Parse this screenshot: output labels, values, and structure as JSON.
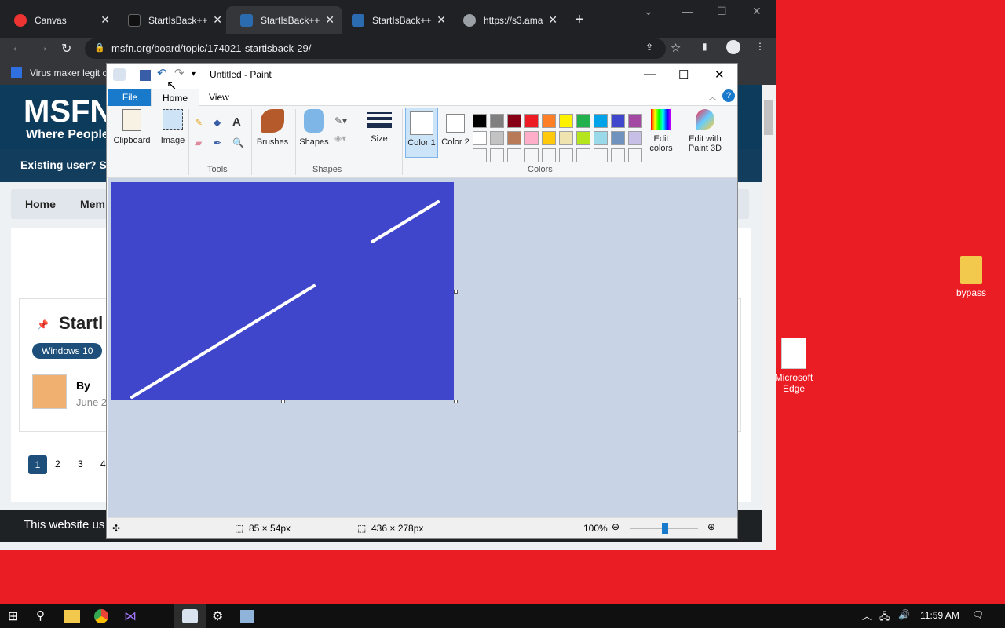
{
  "browser": {
    "tabs": [
      {
        "label": "Canvas",
        "icon": "chrome-red-icon"
      },
      {
        "label": "StartIsBack++",
        "icon": "dark-page-icon"
      },
      {
        "label": "StartIsBack++",
        "icon": "msfn-icon"
      },
      {
        "label": "StartIsBack++",
        "icon": "msfn-icon"
      },
      {
        "label": "https://s3.ama",
        "icon": "globe-icon"
      }
    ],
    "url": "msfn.org/board/topic/174021-startisback-29/",
    "bookmark": "Virus maker legit c"
  },
  "msfn": {
    "logo": "MSFN",
    "tagline": "Where People",
    "signin": "Existing user? Sig",
    "breadcrumb_home": "Home",
    "breadcrumb_members": "Mem",
    "topic_title": "Startl",
    "tag": "Windows 10",
    "by": "By",
    "date": "June 2",
    "pages": [
      "1",
      "2",
      "3",
      "4"
    ],
    "cookie": "This website us"
  },
  "paint": {
    "title": "Untitled - Paint",
    "tabs": {
      "file": "File",
      "home": "Home",
      "view": "View"
    },
    "buttons": {
      "clipboard": "Clipboard",
      "image": "Image",
      "brushes": "Brushes",
      "shapes": "Shapes",
      "size": "Size",
      "color1": "Color 1",
      "color2": "Color 2",
      "edit_colors": "Edit colors",
      "paint3d": "Edit with Paint 3D"
    },
    "groups": {
      "tools": "Tools",
      "shapes": "Shapes",
      "colors": "Colors"
    },
    "palette_row1": [
      "#000000",
      "#7f7f7f",
      "#880015",
      "#ed1c24",
      "#ff7f27",
      "#fff200",
      "#22b14c",
      "#00a2e8",
      "#3f48cc",
      "#a349a4"
    ],
    "palette_row2": [
      "#ffffff",
      "#c3c3c3",
      "#b97a57",
      "#ffaec9",
      "#ffc90e",
      "#efe4b0",
      "#b5e61d",
      "#99d9ea",
      "#7092be",
      "#c8bfe7"
    ],
    "canvas_color": "#4046cc",
    "status": {
      "selection": "85 × 54px",
      "size": "436 × 278px",
      "zoom": "100%"
    }
  },
  "desktop": {
    "icons": [
      {
        "label": "bypass"
      },
      {
        "label": "Microsoft Edge"
      }
    ]
  },
  "taskbar": {
    "time": "11:59 AM"
  }
}
